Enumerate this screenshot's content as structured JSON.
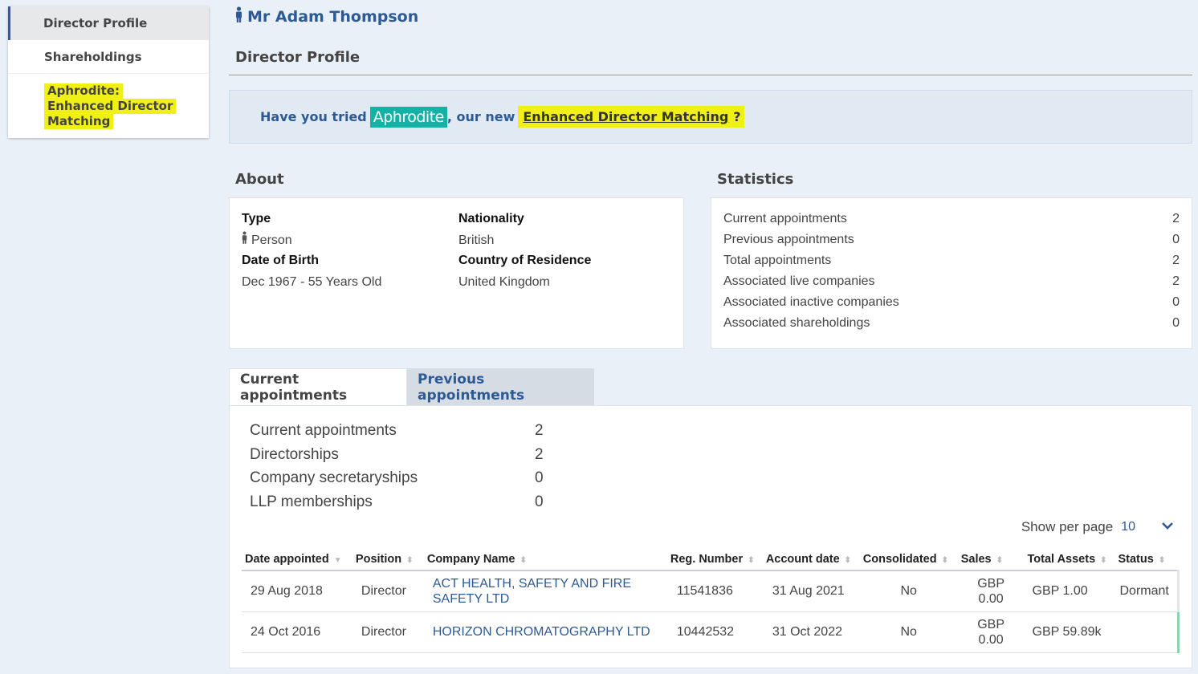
{
  "sidebar": {
    "items": [
      {
        "label": "Director Profile"
      },
      {
        "label": "Shareholdings"
      },
      {
        "label_lines": [
          "Aphrodite:",
          "Enhanced Director",
          "Matching"
        ]
      }
    ]
  },
  "header": {
    "person_name": "Mr Adam Thompson",
    "page_title": "Director Profile"
  },
  "promo": {
    "prefix": "Have you tried",
    "logo_text": "Aphrodite",
    "middle": ", our new",
    "link_text": "Enhanced Director Matching",
    "suffix": "?"
  },
  "about": {
    "heading": "About",
    "type_label": "Type",
    "type_value": "Person",
    "dob_label": "Date of Birth",
    "dob_value": "Dec 1967 - 55 Years Old",
    "nationality_label": "Nationality",
    "nationality_value": "British",
    "residence_label": "Country of Residence",
    "residence_value": "United Kingdom"
  },
  "statistics": {
    "heading": "Statistics",
    "rows": [
      {
        "label": "Current appointments",
        "value": "2"
      },
      {
        "label": "Previous appointments",
        "value": "0"
      },
      {
        "label": "Total appointments",
        "value": "2"
      },
      {
        "label": "Associated live companies",
        "value": "2"
      },
      {
        "label": "Associated inactive companies",
        "value": "0"
      },
      {
        "label": "Associated shareholdings",
        "value": "0"
      }
    ]
  },
  "tabs": {
    "current": "Current appointments",
    "previous": "Previous appointments"
  },
  "summary": [
    {
      "label": "Current appointments",
      "value": "2"
    },
    {
      "label": "Directorships",
      "value": "2"
    },
    {
      "label": "Company secretaryships",
      "value": "0"
    },
    {
      "label": "LLP memberships",
      "value": "0"
    }
  ],
  "pagination": {
    "label": "Show per page",
    "value": "10"
  },
  "table": {
    "headers": [
      "Date appointed",
      "Position",
      "Company Name",
      "Reg. Number",
      "Account date",
      "Consolidated",
      "Sales",
      "Total Assets",
      "Status"
    ],
    "rows": [
      {
        "date": "29 Aug 2018",
        "position": "Director",
        "company_lines": [
          "ACT HEALTH, SAFETY AND FIRE",
          "SAFETY LTD"
        ],
        "reg": "11541836",
        "account": "31 Aug 2021",
        "consolidated": "No",
        "sales_currency": "GBP",
        "sales_value": "0.00",
        "assets": "GBP 1.00",
        "status": "Dormant"
      },
      {
        "date": "24 Oct 2016",
        "position": "Director",
        "company_lines": [
          "HORIZON CHROMATOGRAPHY LTD"
        ],
        "reg": "10442532",
        "account": "31 Oct 2022",
        "consolidated": "No",
        "sales_currency": "GBP",
        "sales_value": "0.00",
        "assets": "GBP 59.89k",
        "status": ""
      }
    ]
  }
}
